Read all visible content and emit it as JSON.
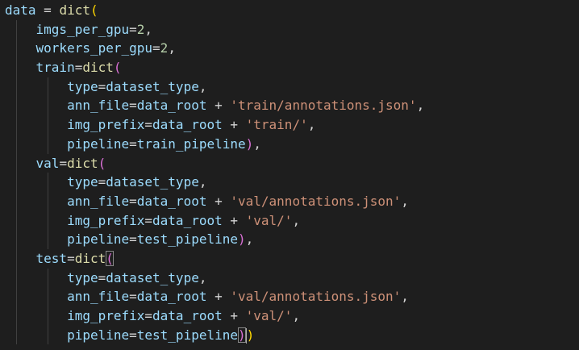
{
  "code_lines": [
    [
      {
        "text": "data",
        "cls": "v",
        "name": "identifier-token"
      },
      {
        "text": " = ",
        "cls": "o",
        "name": "operator-token"
      },
      {
        "text": "dict",
        "cls": "f",
        "name": "function-token"
      },
      {
        "text": "(",
        "cls": "b1",
        "name": "bracket-token"
      }
    ],
    [
      {
        "text": "    "
      },
      {
        "text": "imgs_per_gpu",
        "cls": "v",
        "name": "identifier-token"
      },
      {
        "text": "=",
        "cls": "o",
        "name": "operator-token"
      },
      {
        "text": "2",
        "cls": "n",
        "name": "number-token"
      },
      {
        "text": ",",
        "cls": "o",
        "name": "punctuation-token"
      }
    ],
    [
      {
        "text": "    "
      },
      {
        "text": "workers_per_gpu",
        "cls": "v",
        "name": "identifier-token"
      },
      {
        "text": "=",
        "cls": "o",
        "name": "operator-token"
      },
      {
        "text": "2",
        "cls": "n",
        "name": "number-token"
      },
      {
        "text": ",",
        "cls": "o",
        "name": "punctuation-token"
      }
    ],
    [
      {
        "text": "    "
      },
      {
        "text": "train",
        "cls": "v",
        "name": "identifier-token"
      },
      {
        "text": "=",
        "cls": "o",
        "name": "operator-token"
      },
      {
        "text": "dict",
        "cls": "f",
        "name": "function-token"
      },
      {
        "text": "(",
        "cls": "b2",
        "name": "bracket-token"
      }
    ],
    [
      {
        "text": "        "
      },
      {
        "text": "type",
        "cls": "v",
        "name": "identifier-token"
      },
      {
        "text": "=",
        "cls": "o",
        "name": "operator-token"
      },
      {
        "text": "dataset_type",
        "cls": "v",
        "name": "identifier-token"
      },
      {
        "text": ",",
        "cls": "o",
        "name": "punctuation-token"
      }
    ],
    [
      {
        "text": "        "
      },
      {
        "text": "ann_file",
        "cls": "v",
        "name": "identifier-token"
      },
      {
        "text": "=",
        "cls": "o",
        "name": "operator-token"
      },
      {
        "text": "data_root",
        "cls": "v",
        "name": "identifier-token"
      },
      {
        "text": " + ",
        "cls": "o",
        "name": "operator-token"
      },
      {
        "text": "'train/annotations.json'",
        "cls": "s",
        "name": "string-token"
      },
      {
        "text": ",",
        "cls": "o",
        "name": "punctuation-token"
      }
    ],
    [
      {
        "text": "        "
      },
      {
        "text": "img_prefix",
        "cls": "v",
        "name": "identifier-token"
      },
      {
        "text": "=",
        "cls": "o",
        "name": "operator-token"
      },
      {
        "text": "data_root",
        "cls": "v",
        "name": "identifier-token"
      },
      {
        "text": " + ",
        "cls": "o",
        "name": "operator-token"
      },
      {
        "text": "'train/'",
        "cls": "s",
        "name": "string-token"
      },
      {
        "text": ",",
        "cls": "o",
        "name": "punctuation-token"
      }
    ],
    [
      {
        "text": "        "
      },
      {
        "text": "pipeline",
        "cls": "v",
        "name": "identifier-token"
      },
      {
        "text": "=",
        "cls": "o",
        "name": "operator-token"
      },
      {
        "text": "train_pipeline",
        "cls": "v",
        "name": "identifier-token"
      },
      {
        "text": ")",
        "cls": "b2",
        "name": "bracket-token"
      },
      {
        "text": ",",
        "cls": "o",
        "name": "punctuation-token"
      }
    ],
    [
      {
        "text": "    "
      },
      {
        "text": "val",
        "cls": "v",
        "name": "identifier-token"
      },
      {
        "text": "=",
        "cls": "o",
        "name": "operator-token"
      },
      {
        "text": "dict",
        "cls": "f",
        "name": "function-token"
      },
      {
        "text": "(",
        "cls": "b2",
        "name": "bracket-token"
      }
    ],
    [
      {
        "text": "        "
      },
      {
        "text": "type",
        "cls": "v",
        "name": "identifier-token"
      },
      {
        "text": "=",
        "cls": "o",
        "name": "operator-token"
      },
      {
        "text": "dataset_type",
        "cls": "v",
        "name": "identifier-token"
      },
      {
        "text": ",",
        "cls": "o",
        "name": "punctuation-token"
      }
    ],
    [
      {
        "text": "        "
      },
      {
        "text": "ann_file",
        "cls": "v",
        "name": "identifier-token"
      },
      {
        "text": "=",
        "cls": "o",
        "name": "operator-token"
      },
      {
        "text": "data_root",
        "cls": "v",
        "name": "identifier-token"
      },
      {
        "text": " + ",
        "cls": "o",
        "name": "operator-token"
      },
      {
        "text": "'val/annotations.json'",
        "cls": "s",
        "name": "string-token"
      },
      {
        "text": ",",
        "cls": "o",
        "name": "punctuation-token"
      }
    ],
    [
      {
        "text": "        "
      },
      {
        "text": "img_prefix",
        "cls": "v",
        "name": "identifier-token"
      },
      {
        "text": "=",
        "cls": "o",
        "name": "operator-token"
      },
      {
        "text": "data_root",
        "cls": "v",
        "name": "identifier-token"
      },
      {
        "text": " + ",
        "cls": "o",
        "name": "operator-token"
      },
      {
        "text": "'val/'",
        "cls": "s",
        "name": "string-token"
      },
      {
        "text": ",",
        "cls": "o",
        "name": "punctuation-token"
      }
    ],
    [
      {
        "text": "        "
      },
      {
        "text": "pipeline",
        "cls": "v",
        "name": "identifier-token"
      },
      {
        "text": "=",
        "cls": "o",
        "name": "operator-token"
      },
      {
        "text": "test_pipeline",
        "cls": "v",
        "name": "identifier-token"
      },
      {
        "text": ")",
        "cls": "b2",
        "name": "bracket-token"
      },
      {
        "text": ",",
        "cls": "o",
        "name": "punctuation-token"
      }
    ],
    [
      {
        "text": "    "
      },
      {
        "text": "test",
        "cls": "v",
        "name": "identifier-token"
      },
      {
        "text": "=",
        "cls": "o",
        "name": "operator-token"
      },
      {
        "text": "dict",
        "cls": "f",
        "name": "function-token"
      },
      {
        "text": "(",
        "cls": "b2 cursor-bracket",
        "name": "matched-bracket-token"
      }
    ],
    [
      {
        "text": "        "
      },
      {
        "text": "type",
        "cls": "v",
        "name": "identifier-token"
      },
      {
        "text": "=",
        "cls": "o",
        "name": "operator-token"
      },
      {
        "text": "dataset_type",
        "cls": "v",
        "name": "identifier-token"
      },
      {
        "text": ",",
        "cls": "o",
        "name": "punctuation-token"
      }
    ],
    [
      {
        "text": "        "
      },
      {
        "text": "ann_file",
        "cls": "v",
        "name": "identifier-token"
      },
      {
        "text": "=",
        "cls": "o",
        "name": "operator-token"
      },
      {
        "text": "data_root",
        "cls": "v",
        "name": "identifier-token"
      },
      {
        "text": " + ",
        "cls": "o",
        "name": "operator-token"
      },
      {
        "text": "'val/annotations.json'",
        "cls": "s",
        "name": "string-token"
      },
      {
        "text": ",",
        "cls": "o",
        "name": "punctuation-token"
      }
    ],
    [
      {
        "text": "        "
      },
      {
        "text": "img_prefix",
        "cls": "v",
        "name": "identifier-token"
      },
      {
        "text": "=",
        "cls": "o",
        "name": "operator-token"
      },
      {
        "text": "data_root",
        "cls": "v",
        "name": "identifier-token"
      },
      {
        "text": " + ",
        "cls": "o",
        "name": "operator-token"
      },
      {
        "text": "'val/'",
        "cls": "s",
        "name": "string-token"
      },
      {
        "text": ",",
        "cls": "o",
        "name": "punctuation-token"
      }
    ],
    [
      {
        "text": "        "
      },
      {
        "text": "pipeline",
        "cls": "v",
        "name": "identifier-token"
      },
      {
        "text": "=",
        "cls": "o",
        "name": "operator-token"
      },
      {
        "text": "test_pipeline",
        "cls": "v",
        "name": "identifier-token"
      },
      {
        "text": ")",
        "cls": "b2 cursor-bracket",
        "name": "matched-bracket-token"
      },
      {
        "caret": true
      },
      {
        "text": ")",
        "cls": "b1",
        "name": "bracket-token"
      }
    ]
  ],
  "indent_guides": [
    0,
    1,
    1,
    1,
    2,
    2,
    2,
    2,
    1,
    2,
    2,
    2,
    2,
    1,
    2,
    2,
    2,
    2
  ],
  "colors": {
    "background": "#1e1e1e",
    "variable": "#9cdcfe",
    "operator": "#d4d4d4",
    "function": "#dcdcaa",
    "string": "#ce9178",
    "number": "#b5cea8",
    "bracket_level_1": "#ffd700",
    "bracket_level_2": "#da70d6",
    "indent_guide": "#404040"
  }
}
